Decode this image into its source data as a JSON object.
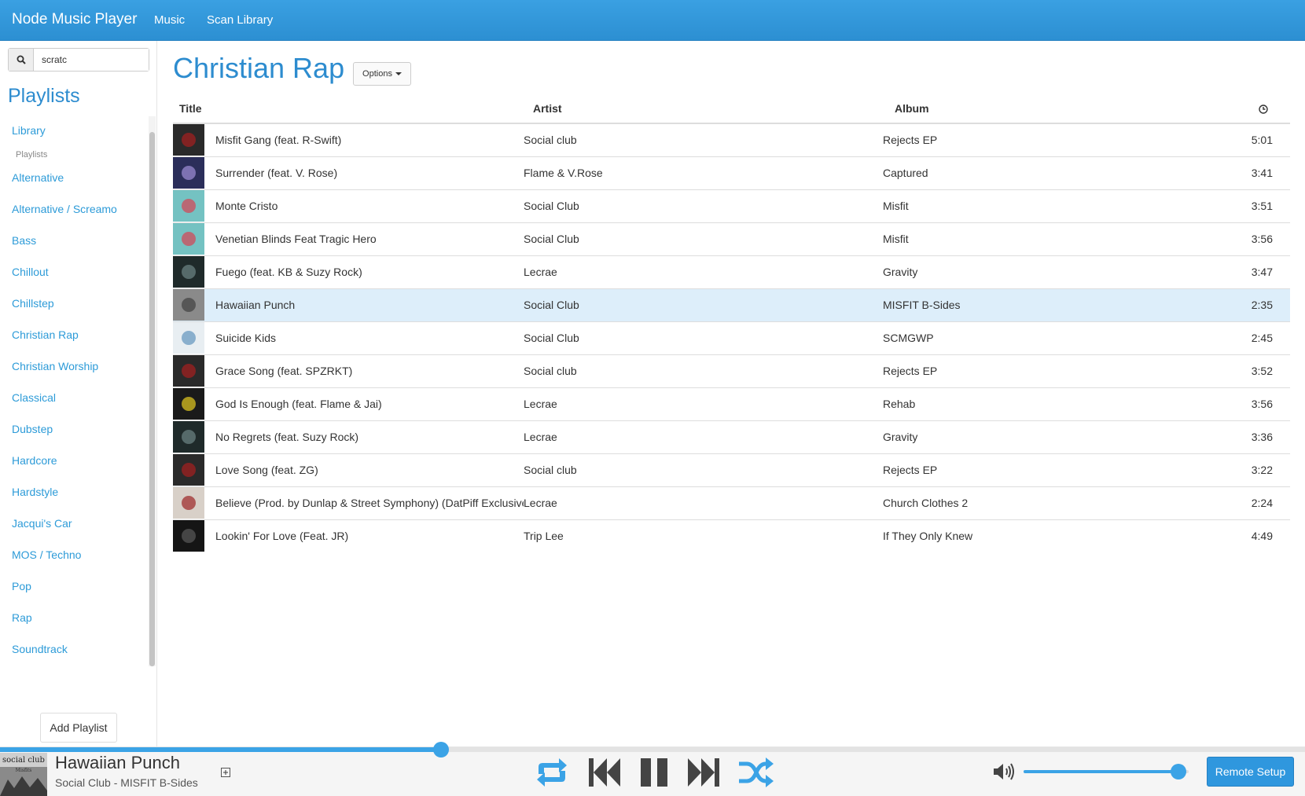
{
  "navbar": {
    "brand": "Node Music Player",
    "links": [
      "Music",
      "Scan Library"
    ]
  },
  "sidebar": {
    "search": {
      "value": "scratc",
      "icon": "search-icon"
    },
    "title": "Playlists",
    "library_label": "Library",
    "section_header": "Playlists",
    "playlists": [
      "Alternative",
      "Alternative / Screamo",
      "Bass",
      "Chillout",
      "Chillstep",
      "Christian Rap",
      "Christian Worship",
      "Classical",
      "Dubstep",
      "Hardcore",
      "Hardstyle",
      "Jacqui's Car",
      "MOS / Techno",
      "Pop",
      "Rap",
      "Soundtrack"
    ],
    "add_playlist_label": "Add Playlist"
  },
  "main": {
    "title": "Christian Rap",
    "options_label": "Options",
    "columns": {
      "title": "Title",
      "artist": "Artist",
      "album": "Album",
      "duration_icon": "clock-icon"
    },
    "tracks": [
      {
        "title": "Misfit Gang (feat. R-Swift)",
        "artist": "Social club",
        "album": "Rejects EP",
        "duration": "5:01",
        "art_color": "#2a2a2a",
        "accent": "#a02020"
      },
      {
        "title": "Surrender (feat. V. Rose)",
        "artist": "Flame & V.Rose",
        "album": "Captured",
        "duration": "3:41",
        "art_color": "#2b2e5a",
        "accent": "#9a8ad0"
      },
      {
        "title": "Monte Cristo",
        "artist": "Social Club",
        "album": "Misfit",
        "duration": "3:51",
        "art_color": "#74c2c2",
        "accent": "#d04a5a"
      },
      {
        "title": "Venetian Blinds Feat Tragic Hero",
        "artist": "Social Club",
        "album": "Misfit",
        "duration": "3:56",
        "art_color": "#74c2c2",
        "accent": "#d04a5a"
      },
      {
        "title": "Fuego (feat. KB & Suzy Rock)",
        "artist": "Lecrae",
        "album": "Gravity",
        "duration": "3:47",
        "art_color": "#1f2a2a",
        "accent": "#6a8080"
      },
      {
        "title": "Hawaiian Punch",
        "artist": "Social Club",
        "album": "MISFIT B-Sides",
        "duration": "2:35",
        "art_color": "#8a8a8a",
        "accent": "#444444"
      },
      {
        "title": "Suicide Kids",
        "artist": "Social Club",
        "album": "SCMGWP",
        "duration": "2:45",
        "art_color": "#e8eef2",
        "accent": "#6a9ac0"
      },
      {
        "title": "Grace Song (feat. SPZRKT)",
        "artist": "Social club",
        "album": "Rejects EP",
        "duration": "3:52",
        "art_color": "#2a2a2a",
        "accent": "#a02020"
      },
      {
        "title": "God Is Enough (feat. Flame & Jai)",
        "artist": "Lecrae",
        "album": "Rehab",
        "duration": "3:56",
        "art_color": "#1a1a1a",
        "accent": "#d8c020"
      },
      {
        "title": "No Regrets (feat. Suzy Rock)",
        "artist": "Lecrae",
        "album": "Gravity",
        "duration": "3:36",
        "art_color": "#1f2a2a",
        "accent": "#6a8080"
      },
      {
        "title": "Love Song (feat. ZG)",
        "artist": "Social club",
        "album": "Rejects EP",
        "duration": "3:22",
        "art_color": "#2a2a2a",
        "accent": "#a02020"
      },
      {
        "title": "Believe (Prod. by Dunlap & Street Symphony) (DatPiff Exclusive)",
        "artist": "Lecrae",
        "album": "Church Clothes 2",
        "duration": "2:24",
        "art_color": "#d8d0c8",
        "accent": "#a03030"
      },
      {
        "title": "Lookin' For Love (Feat. JR)",
        "artist": "Trip Lee",
        "album": "If They Only Knew",
        "duration": "4:49",
        "art_color": "#151515",
        "accent": "#555555"
      }
    ],
    "active_index": 5
  },
  "player": {
    "now_playing_title": "Hawaiian Punch",
    "now_playing_sub": "Social Club - MISFIT B-Sides",
    "progress": 0.338,
    "volume": 0.94,
    "remote_label": "Remote Setup",
    "accent": "#3ba3e6"
  }
}
